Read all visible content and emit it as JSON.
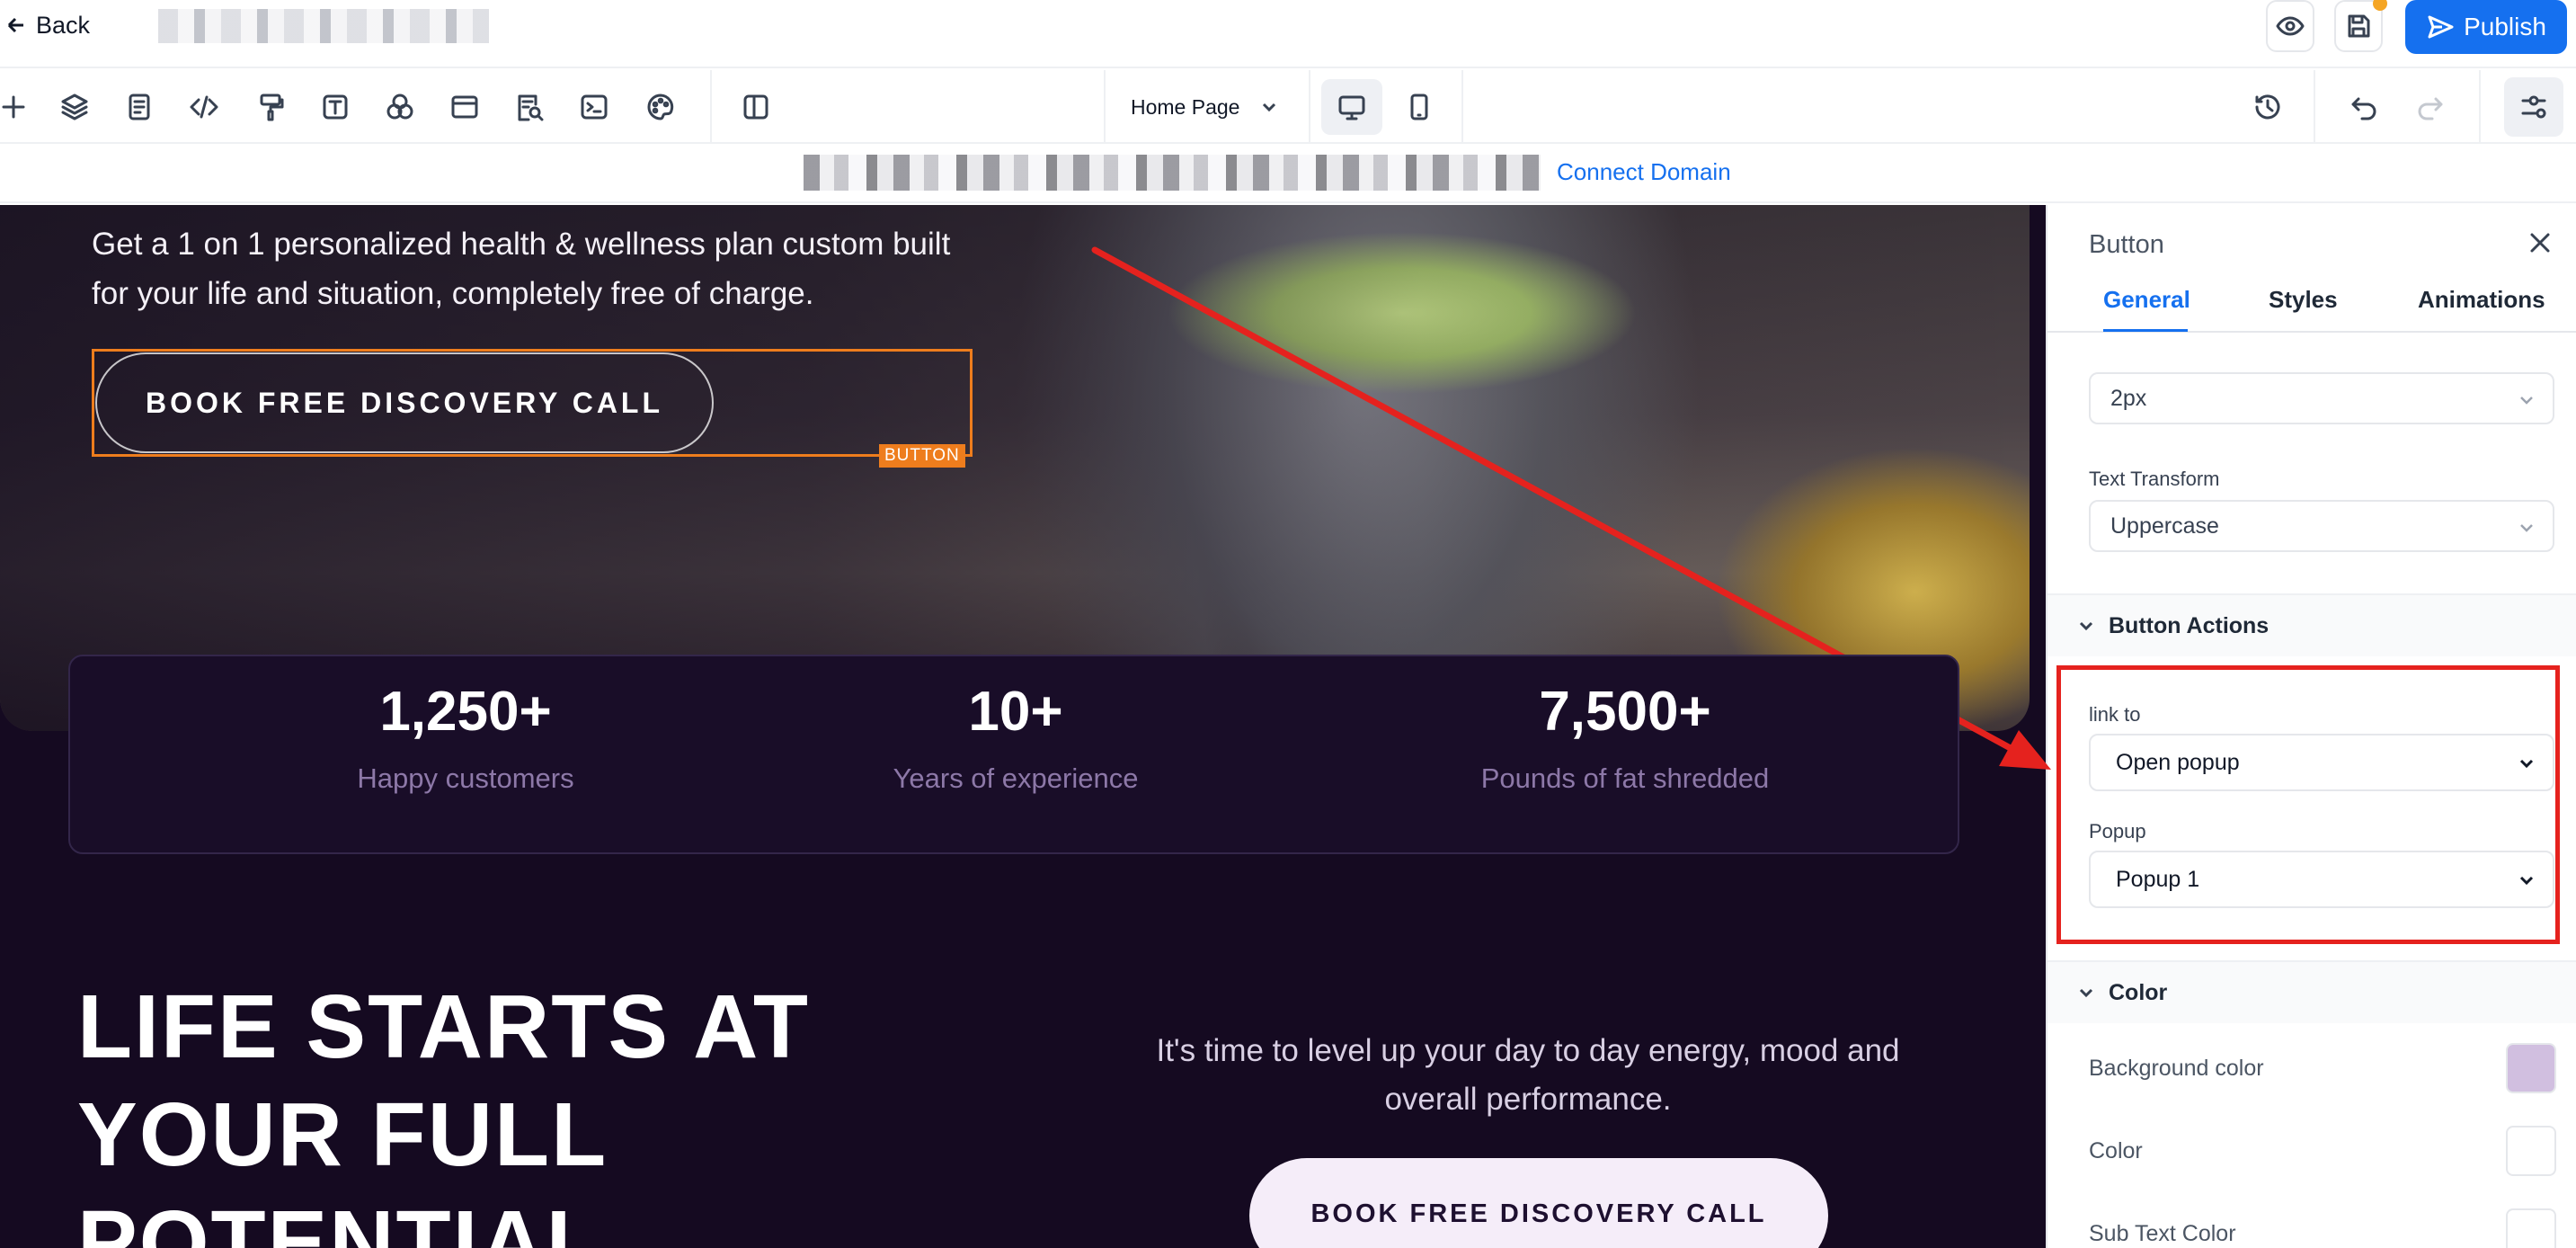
{
  "topbar": {
    "back_label": "Back",
    "publish_label": "Publish"
  },
  "toolbar": {
    "page_select_value": "Home Page"
  },
  "domainbar": {
    "connect_label": "Connect Domain"
  },
  "hero": {
    "subtitle": "Get a 1 on 1 personalized health & wellness plan custom built for your life and situation, completely free of charge.",
    "button_label": "BOOK FREE DISCOVERY CALL",
    "selected_tag": "BUTTON"
  },
  "stats": [
    {
      "value": "1,250+",
      "label": "Happy customers"
    },
    {
      "value": "10+",
      "label": "Years of experience"
    },
    {
      "value": "7,500+",
      "label": "Pounds of fat shredded"
    }
  ],
  "section": {
    "headline": "LIFE STARTS AT YOUR FULL POTENTIAL",
    "body": "It's time to level up your day to day energy, mood and overall performance.",
    "button_label": "BOOK FREE DISCOVERY CALL"
  },
  "panel": {
    "title": "Button",
    "tabs": [
      "General",
      "Styles",
      "Animations"
    ],
    "letter_spacing_value": "2px",
    "text_transform_label": "Text Transform",
    "text_transform_value": "Uppercase",
    "button_actions_label": "Button Actions",
    "link_to_label": "link to",
    "link_to_value": "Open popup",
    "popup_label": "Popup",
    "popup_value": "Popup 1",
    "color_section_label": "Color",
    "bg_color_label": "Background color",
    "color_label": "Color",
    "subtext_color_label": "Sub Text Color"
  },
  "colors": {
    "accent": "#1570ef",
    "selection": "#ee7d1d",
    "annotation": "#e5221e",
    "canvas_bg": "#150a21",
    "bg_swatch": "#d1bfe0",
    "color_swatch": "#ffffff",
    "subtext_swatch": "#ffffff"
  }
}
